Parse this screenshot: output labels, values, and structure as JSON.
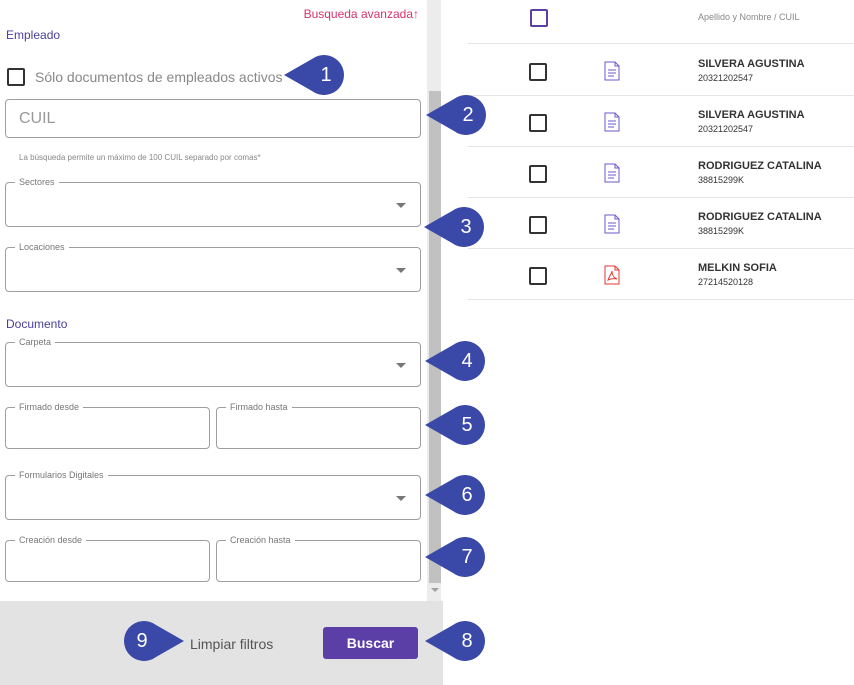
{
  "filters": {
    "advanced_link": "Busqueda avanzada",
    "advanced_arrow": "↑",
    "employee_section": "Empleado",
    "active_only_label": "Sólo documentos de empleados activos",
    "cuil_placeholder": "CUIL",
    "cuil_hint": "La búsqueda permite un máximo de 100 CUIL separado por comas*",
    "sectores_label": "Sectores",
    "locaciones_label": "Locaciones",
    "document_section": "Documento",
    "carpeta_label": "Carpeta",
    "firmado_desde_label": "Firmado desde",
    "firmado_hasta_label": "Firmado hasta",
    "formularios_label": "Formularios Digitales",
    "creacion_desde_label": "Creación desde",
    "creacion_hasta_label": "Creación hasta"
  },
  "actions": {
    "clear_label": "Limpiar filtros",
    "search_label": "Buscar"
  },
  "table": {
    "header_label": "Apellido y Nombre / CUIL",
    "rows": [
      {
        "name": "SILVERA AGUSTINA",
        "cuil": "20321202547",
        "icon": "document-icon"
      },
      {
        "name": "SILVERA AGUSTINA",
        "cuil": "20321202547",
        "icon": "document-icon"
      },
      {
        "name": "RODRIGUEZ CATALINA",
        "cuil": "38815299K",
        "icon": "document-icon"
      },
      {
        "name": "RODRIGUEZ CATALINA",
        "cuil": "38815299K",
        "icon": "document-icon"
      },
      {
        "name": "MELKIN SOFIA",
        "cuil": "27214520128",
        "icon": "pdf-icon"
      }
    ]
  },
  "callouts": [
    "1",
    "2",
    "3",
    "4",
    "5",
    "6",
    "7",
    "8",
    "9"
  ],
  "colors": {
    "accent": "#5b3fa6",
    "link": "#d6336c",
    "callout": "#3a48a8",
    "pdf": "#e53935"
  }
}
